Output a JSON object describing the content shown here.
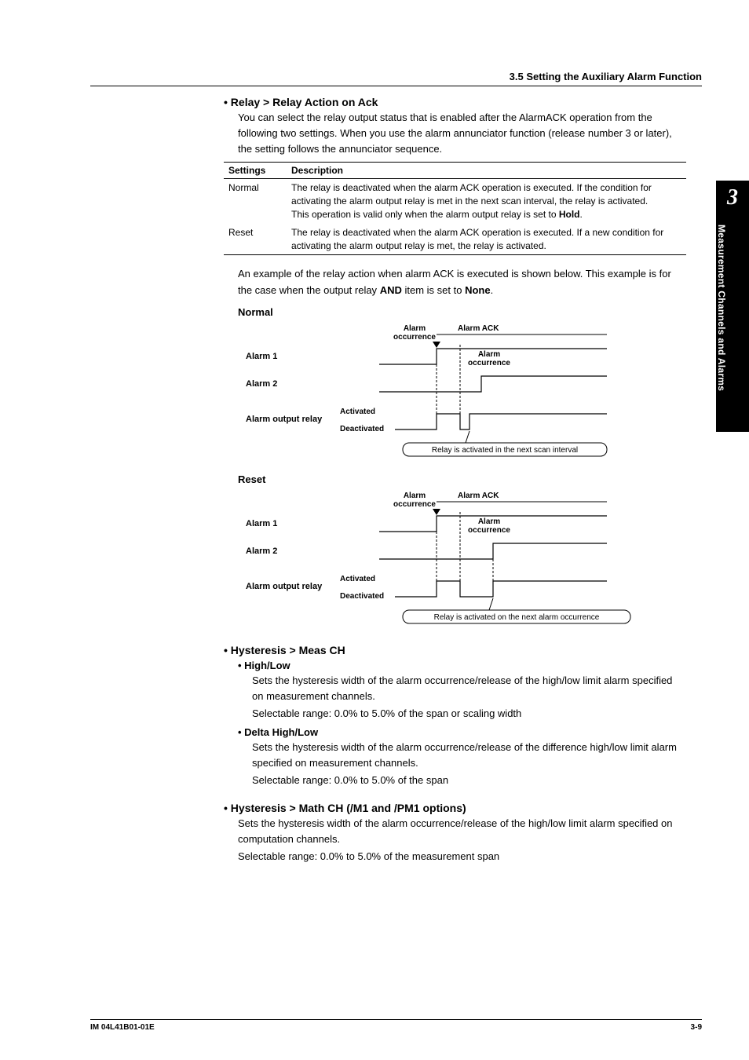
{
  "header": {
    "section": "3.5  Setting the Auxiliary Alarm Function"
  },
  "sidetab": {
    "chapter": "3",
    "title": "Measurement Channels and Alarms"
  },
  "s1": {
    "title": "Relay > Relay Action on Ack",
    "p1": "You can select the relay output status that is enabled after the AlarmACK operation from the following two settings. When you use the alarm annunciator function (release number 3 or later), the setting follows the annunciator sequence."
  },
  "table": {
    "h1": "Settings",
    "h2": "Description",
    "r1c1": "Normal",
    "r1c2": "The relay is deactivated when the alarm ACK operation is executed. If the condition for activating the alarm output relay is met in the next scan interval, the relay is activated.",
    "r1c2b": "This operation is valid only when the alarm output relay is set to ",
    "r1c2b_bold": "Hold",
    "r1c2b_end": ".",
    "r2c1": "Reset",
    "r2c2": "The relay is deactivated when the alarm ACK operation is executed. If a new condition for activating the alarm output relay is met, the relay is activated."
  },
  "example": {
    "p1a": "An example of the relay action when alarm ACK is executed is shown below. This example is for the case when the output relay ",
    "bold1": "AND",
    "mid": " item is set to ",
    "bold2": "None",
    "end": "."
  },
  "diag": {
    "normal": "Normal",
    "reset": "Reset",
    "alarm_occurrence": "Alarm",
    "occurrence_word": "occurrence",
    "alarm_ack": "Alarm ACK",
    "alarm1": "Alarm 1",
    "alarm2": "Alarm 2",
    "alarm_output_relay": "Alarm output relay",
    "activated": "Activated",
    "deactivated": "Deactivated",
    "alarm_occ2": "Alarm",
    "note_normal": "Relay is activated in the next scan interval",
    "note_reset": "Relay is activated on the next alarm occurrence"
  },
  "s2": {
    "title": "Hysteresis > Meas CH",
    "sub1": "High/Low",
    "sub1_p": "Sets the hysteresis width of the alarm occurrence/release of the high/low limit alarm specified on measurement channels.",
    "sub1_range": "Selectable range: 0.0% to 5.0% of the span or scaling width",
    "sub2": "Delta High/Low",
    "sub2_p": "Sets the hysteresis width of the alarm occurrence/release of the difference high/low limit alarm specified on measurement channels.",
    "sub2_range": "Selectable range: 0.0% to 5.0% of the span"
  },
  "s3": {
    "title": "Hysteresis > Math CH (/M1 and /PM1 options)",
    "p": "Sets the hysteresis width of the alarm occurrence/release of the high/low limit alarm specified on computation channels.",
    "range": "Selectable range: 0.0% to 5.0% of the measurement span"
  },
  "footer": {
    "left": "IM 04L41B01-01E",
    "right": "3-9"
  }
}
